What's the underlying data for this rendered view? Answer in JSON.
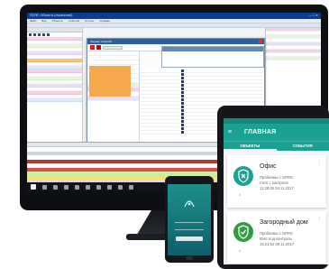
{
  "desktop": {
    "title": "ПОЛЕ: Объекты (локальный)",
    "menu": [
      "Файл",
      "Вид",
      "Объекты",
      "События",
      "Отчеты",
      "Справка"
    ],
    "window_title": "Журнал событий"
  },
  "tablet": {
    "title": "ГЛАВНАЯ",
    "tabs": [
      "ОБЪЕКТЫ",
      "СОБЫТИЯ"
    ],
    "objects": [
      {
        "name": "Офис",
        "line1": "Проблемы с GPRS",
        "line2": "Снят с контроля",
        "line3": "11:28:45 04.11.2017",
        "status_color": "#1aa192",
        "icon": "shield-x-icon"
      },
      {
        "name": "Загородный дом",
        "line1": "Проблемы с GPRS",
        "line2": "Взят под контроль",
        "line3": "15:21:52 09.11.2017",
        "status_color": "#2e9e3e",
        "icon": "shield-check-icon"
      }
    ]
  },
  "colors": {
    "accent_teal": "#1aa192",
    "desktop_titlebar": "#0a3c8f",
    "highlight_orange": "#f6a94b"
  }
}
